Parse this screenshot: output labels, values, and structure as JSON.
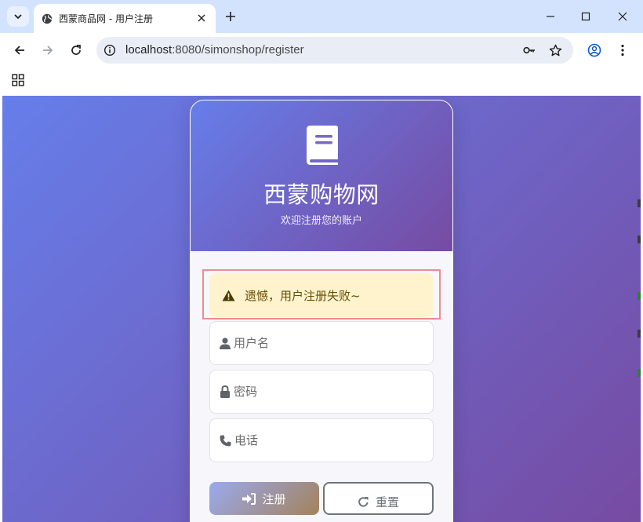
{
  "browser": {
    "tab_title": "西蒙商品网 - 用户注册",
    "url_host": "localhost",
    "url_rest": ":8080/simonshop/register"
  },
  "page": {
    "brand": "西蒙购物网",
    "tagline": "欢迎注册您的账户",
    "alert_message": "遗憾，用户注册失败~",
    "username_placeholder": "用户名",
    "password_placeholder": "密码",
    "phone_placeholder": "电话",
    "submit_label": "注册",
    "reset_label": "重置"
  },
  "colors": {
    "gradient_start": "#667eea",
    "gradient_end": "#764ba2",
    "alert_bg": "#fff3cd",
    "alert_text": "#664d03",
    "reset_border": "#6c757d"
  },
  "icons": [
    "chevron-down-icon",
    "globe-icon",
    "close-icon",
    "plus-icon",
    "minimize-icon",
    "maximize-icon",
    "back-icon",
    "forward-icon",
    "reload-icon",
    "info-icon",
    "key-icon",
    "star-icon",
    "profile-icon",
    "kebab-menu-icon",
    "apps-grid-icon",
    "book-icon",
    "warning-icon",
    "user-icon",
    "lock-icon",
    "phone-icon",
    "sign-in-icon",
    "redo-icon"
  ]
}
